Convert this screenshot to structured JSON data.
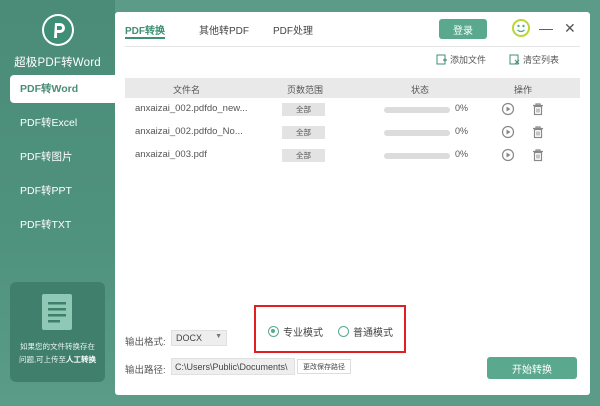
{
  "app": {
    "title": "超极PDF转Word"
  },
  "sidebar": {
    "items": [
      {
        "label": "PDF转Word",
        "active": true
      },
      {
        "label": "PDF转Excel",
        "active": false
      },
      {
        "label": "PDF转图片",
        "active": false
      },
      {
        "label": "PDF转PPT",
        "active": false
      },
      {
        "label": "PDF转TXT",
        "active": false
      }
    ],
    "promo": {
      "line1": "如果您的文件转换存在",
      "line2": "问题,可上传至",
      "link": "人工转换"
    }
  },
  "header": {
    "tabs": [
      {
        "label": "PDF转换",
        "active": true
      },
      {
        "label": "其他转PDF",
        "active": false
      },
      {
        "label": "PDF处理",
        "active": false
      }
    ],
    "login_label": "登录",
    "minimize": "—",
    "close": "✕"
  },
  "toolbar": {
    "add_file": "添加文件",
    "clear_list": "清空列表"
  },
  "table": {
    "columns": [
      "文件名",
      "页数范围",
      "状态",
      "操作"
    ],
    "rows": [
      {
        "file": "anxaizai_002.pdfdo_new...",
        "range": "全部",
        "percent": "0%",
        "progress": 0
      },
      {
        "file": "anxaizai_002.pdfdo_No...",
        "range": "全部",
        "percent": "0%",
        "progress": 0
      },
      {
        "file": "anxaizai_003.pdf",
        "range": "全部",
        "percent": "0%",
        "progress": 0
      }
    ]
  },
  "output": {
    "format_label": "输出格式:",
    "format_value": "DOCX",
    "modes": [
      {
        "label": "专业模式",
        "selected": true
      },
      {
        "label": "普通模式",
        "selected": false
      }
    ],
    "path_label": "输出路径:",
    "path_value": "C:\\Users\\Public\\Documents\\",
    "change_path": "更改保存路径",
    "start": "开始转换"
  },
  "colors": {
    "accent": "#5aa88e",
    "sidebar": "#4a8c78",
    "highlight_box": "#e02020"
  }
}
